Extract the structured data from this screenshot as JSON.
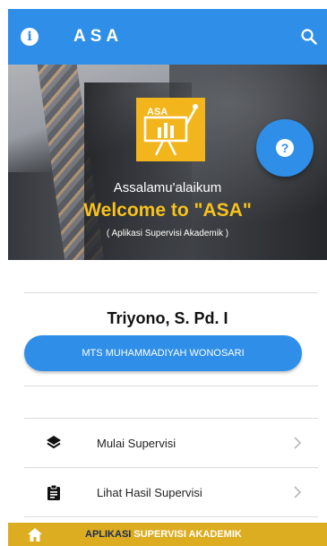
{
  "app_bar": {
    "title": "ASA",
    "info_icon": "info-icon",
    "search_icon": "search-icon",
    "color": "#2f8fe8"
  },
  "hero": {
    "greeting": "Assalamu'alaikum",
    "welcome": "Welcome to \"ASA\"",
    "subtitle": "( Aplikasi Supervisi Akademik )",
    "logo_text": "ASA",
    "welcome_color": "#f7c21c",
    "logo_color": "#f2b51c"
  },
  "help_fab": {
    "icon": "help-icon"
  },
  "profile": {
    "name": "Triyono, S. Pd. I",
    "school": "MTS MUHAMMADIYAH WONOSARI"
  },
  "menu": {
    "items": [
      {
        "label": "Mulai Supervisi",
        "icon": "layers-icon"
      },
      {
        "label": "Lihat Hasil Supervisi",
        "icon": "clipboard-icon"
      }
    ]
  },
  "bottom_bar": {
    "home_icon": "home-icon",
    "text_part1": "APLIKASI",
    "text_part2": "SUPERVISI AKADEMIK",
    "color": "#dcad20"
  }
}
